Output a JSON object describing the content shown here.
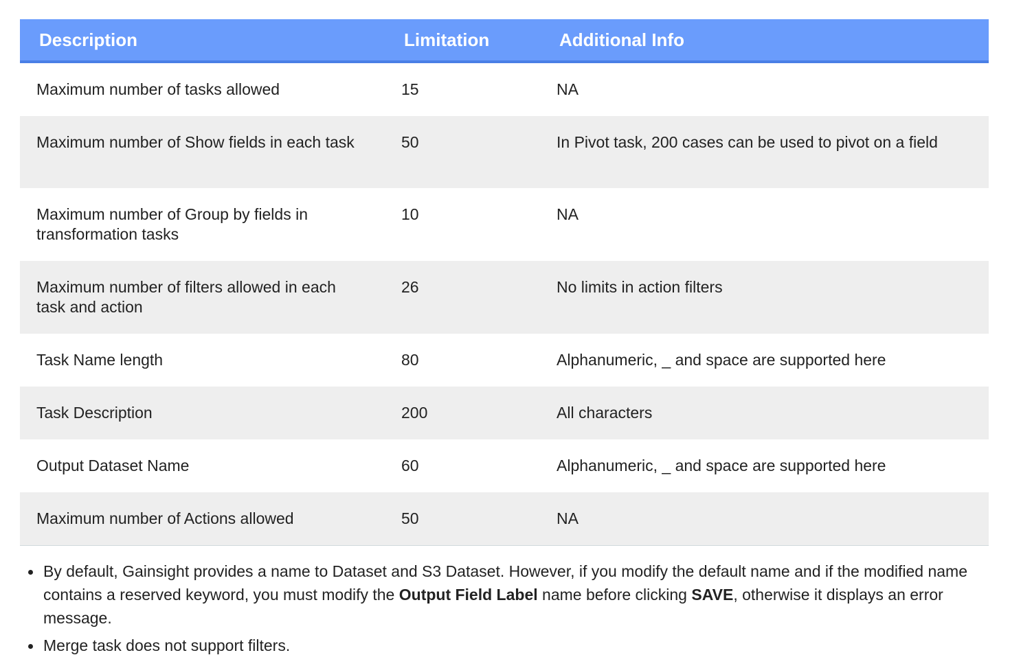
{
  "table": {
    "headers": [
      "Description",
      "Limitation",
      "Additional Info"
    ],
    "rows": [
      {
        "description": "Maximum number of tasks allowed",
        "limitation": "15",
        "info": "NA"
      },
      {
        "description": "Maximum number of Show fields in each task",
        "limitation": "50",
        "info": "In Pivot task, 200 cases can be used to pivot on a field"
      },
      {
        "description": "Maximum number of Group by fields in transformation tasks",
        "limitation": "10",
        "info": "NA"
      },
      {
        "description": "Maximum number of filters allowed in each task and action",
        "limitation": "26",
        "info": "No limits in action filters"
      },
      {
        "description": "Task Name length",
        "limitation": "80",
        "info": "Alphanumeric, _ and space are supported here"
      },
      {
        "description": "Task Description",
        "limitation": "200",
        "info": "All characters"
      },
      {
        "description": "Output Dataset Name",
        "limitation": "60",
        "info": "Alphanumeric, _ and space are supported here"
      },
      {
        "description": "Maximum number of Actions allowed",
        "limitation": "50",
        "info": "NA"
      }
    ]
  },
  "notes": {
    "item1": {
      "part1": "By default, Gainsight provides a name to Dataset and S3 Dataset. However, if you modify the default name and if the modified name contains a reserved keyword, you must modify the ",
      "bold1": "Output Field Label",
      "part2": " name before clicking ",
      "bold2": "SAVE",
      "part3": ", otherwise it displays an error message."
    },
    "item2": "Merge task does not support filters."
  },
  "colors": {
    "header_bg": "#6a9cfc",
    "header_text": "#ffffff",
    "row_alt_bg": "#eeeeee"
  }
}
